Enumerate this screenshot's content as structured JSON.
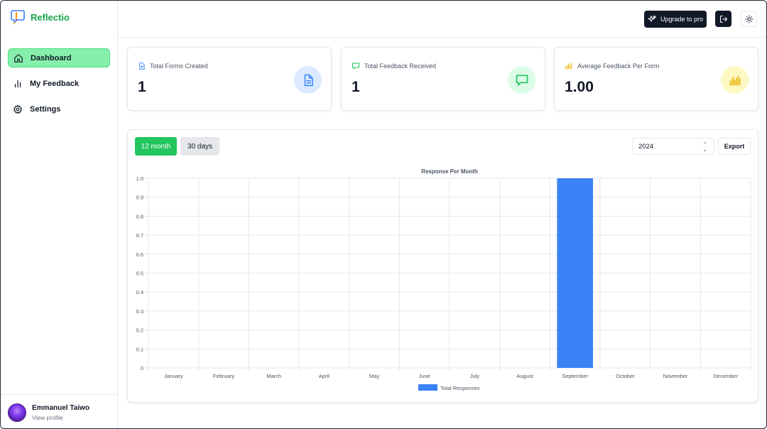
{
  "app": {
    "name": "Reflectio"
  },
  "sidebar": {
    "items": [
      {
        "label": "Dashboard",
        "icon": "home-icon",
        "active": true
      },
      {
        "label": "My Feedback",
        "icon": "bar-chart-icon",
        "active": false
      },
      {
        "label": "Settings",
        "icon": "gear-icon",
        "active": false
      }
    ]
  },
  "profile": {
    "name": "Emmanuel Taiwo",
    "link": "View profile"
  },
  "header": {
    "upgrade_label": "Upgrade to pro"
  },
  "stats": [
    {
      "label": "Total Forms Created",
      "value": "1",
      "icon": "document-icon",
      "color": "#3b82f6",
      "bg": "#dbeafe"
    },
    {
      "label": "Total Feedback Received",
      "value": "1",
      "icon": "message-icon",
      "color": "#22c55e",
      "bg": "#dcfce7"
    },
    {
      "label": "Average Feedback Per Form",
      "value": "1.00",
      "icon": "bar-chart-icon",
      "color": "#eab308",
      "bg": "#fef9c3"
    }
  ],
  "controls": {
    "tab_12_month": "12 month",
    "tab_30_days": "30 days",
    "year": "2024",
    "export_label": "Export"
  },
  "chart_data": {
    "type": "bar",
    "title": "Response Per Month",
    "categories": [
      "January",
      "February",
      "March",
      "April",
      "May",
      "June",
      "July",
      "August",
      "September",
      "October",
      "November",
      "December"
    ],
    "series": [
      {
        "name": "Total Responses",
        "values": [
          0,
          0,
          0,
          0,
          0,
          0,
          0,
          0,
          1,
          0,
          0,
          0
        ],
        "color": "#3b82f6"
      }
    ],
    "ylim": [
      0,
      1
    ],
    "yticks": [
      "0",
      "0.1",
      "0.2",
      "0.3",
      "0.4",
      "0.5",
      "0.6",
      "0.7",
      "0.8",
      "0.9",
      "1.0"
    ],
    "grid": true,
    "legend": "bottom"
  }
}
